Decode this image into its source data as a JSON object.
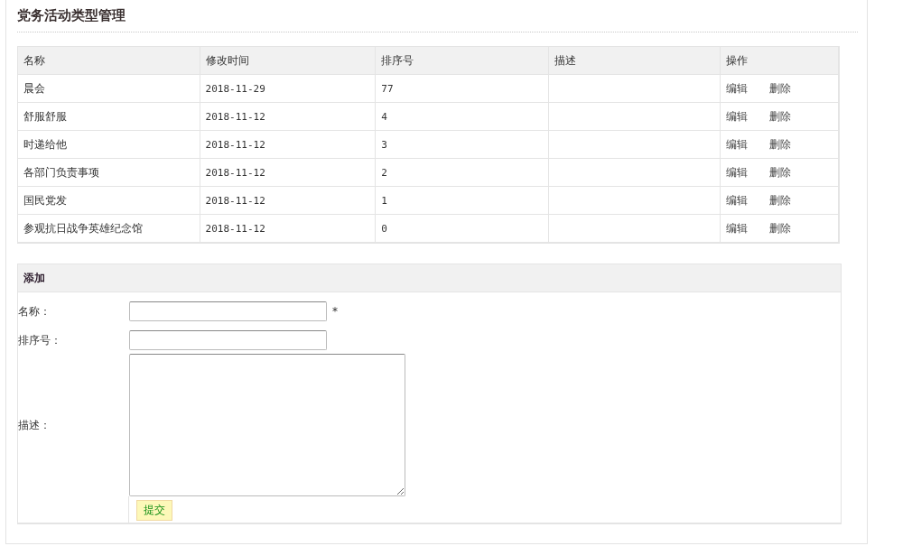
{
  "page_title": "党务活动类型管理",
  "table": {
    "columns": [
      "名称",
      "修改时间",
      "排序号",
      "描述",
      "操作"
    ],
    "rows": [
      {
        "name": "晨会",
        "modified": "2018-11-29",
        "order": "77",
        "actions": [
          "编辑",
          "删除"
        ]
      },
      {
        "name": "舒服舒服",
        "modified": "2018-11-12",
        "order": "4",
        "actions": [
          "编辑",
          "删除"
        ]
      },
      {
        "name": "时递给他",
        "modified": "2018-11-12",
        "order": "3",
        "actions": [
          "编辑",
          "删除"
        ]
      },
      {
        "name": "各部门负责事项",
        "modified": "2018-11-12",
        "order": "2",
        "actions": [
          "编辑",
          "删除"
        ]
      },
      {
        "name": "国民党发",
        "modified": "2018-11-12",
        "order": "1",
        "actions": [
          "编辑",
          "删除"
        ]
      },
      {
        "name": "参观抗日战争英雄纪念馆",
        "modified": "2018-11-12",
        "order": "0",
        "actions": [
          "编辑",
          "删除"
        ]
      }
    ]
  },
  "add_form": {
    "title": "添加",
    "fields": [
      {
        "kind": "input",
        "label": "名称：",
        "required_mark": "*"
      },
      {
        "kind": "input",
        "label": "排序号："
      },
      {
        "kind": "textarea",
        "label": "描述："
      }
    ],
    "submit": "提交"
  }
}
